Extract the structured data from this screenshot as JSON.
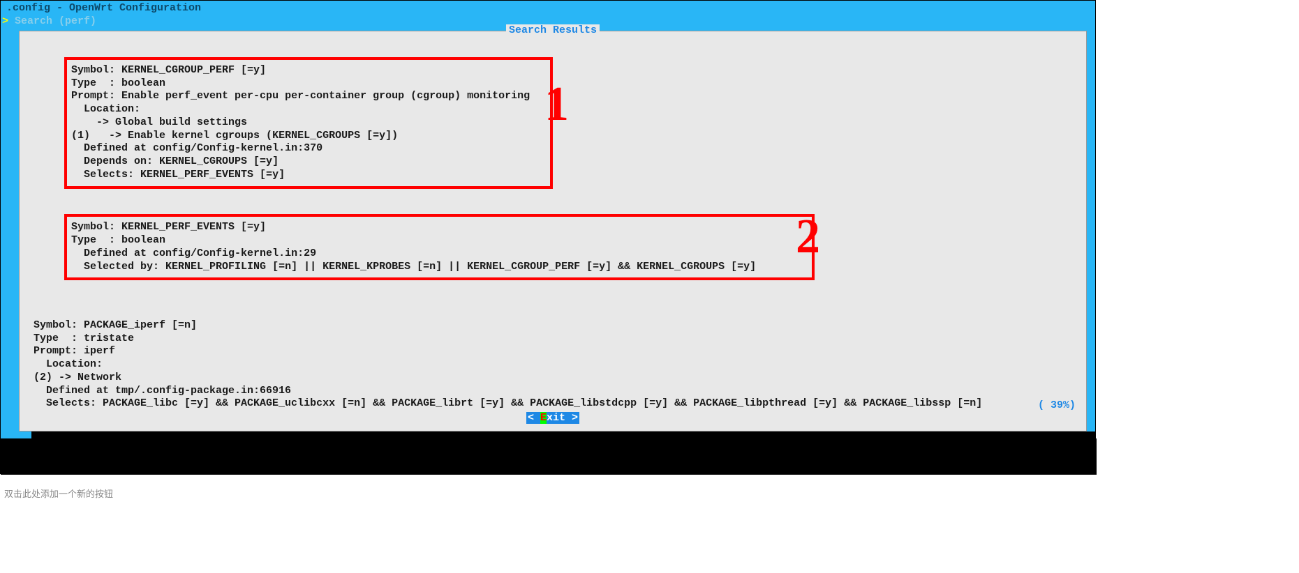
{
  "title": ".config - OpenWrt Configuration",
  "breadcrumb_arrow": ">",
  "breadcrumb": " Search (perf) ",
  "dialog_title": " Search Results ",
  "percentage": "( 39%)",
  "exit_prefix": "< ",
  "exit_key": "E",
  "exit_suffix": "xit >",
  "annotations": {
    "one": "1",
    "two": "2"
  },
  "bottom_hint": "双击此处添加一个新的按钮",
  "results": [
    {
      "lines": [
        "Symbol: KERNEL_CGROUP_PERF [=y]",
        "Type  : boolean",
        "Prompt: Enable perf_event per-cpu per-container group (cgroup) monitoring",
        "  Location:",
        "    -> Global build settings",
        "(1)   -> Enable kernel cgroups (KERNEL_CGROUPS [=y])",
        "  Defined at config/Config-kernel.in:370",
        "  Depends on: KERNEL_CGROUPS [=y]",
        "  Selects: KERNEL_PERF_EVENTS [=y]"
      ]
    },
    {
      "lines": [
        "Symbol: KERNEL_PERF_EVENTS [=y]",
        "Type  : boolean",
        "  Defined at config/Config-kernel.in:29",
        "  Selected by: KERNEL_PROFILING [=n] || KERNEL_KPROBES [=n] || KERNEL_CGROUP_PERF [=y] && KERNEL_CGROUPS [=y]"
      ]
    },
    {
      "lines": [
        "Symbol: PACKAGE_iperf [=n]",
        "Type  : tristate",
        "Prompt: iperf",
        "  Location:",
        "(2) -> Network",
        "  Defined at tmp/.config-package.in:66916",
        "  Selects: PACKAGE_libc [=y] && PACKAGE_uclibcxx [=n] && PACKAGE_librt [=y] && PACKAGE_libstdcpp [=y] && PACKAGE_libpthread [=y] && PACKAGE_libssp [=n]"
      ]
    }
  ]
}
